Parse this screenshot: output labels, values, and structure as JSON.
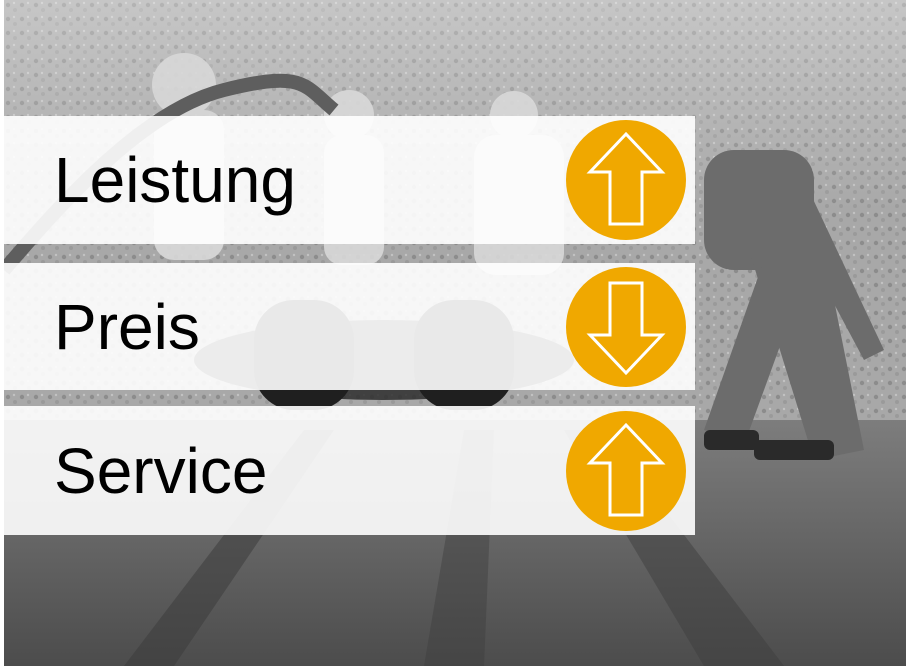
{
  "rows": [
    {
      "label": "Leistung",
      "trend": "up",
      "icon": "arrow-up-icon"
    },
    {
      "label": "Preis",
      "trend": "down",
      "icon": "arrow-down-icon"
    },
    {
      "label": "Service",
      "trend": "up",
      "icon": "arrow-up-icon"
    }
  ],
  "colors": {
    "accent": "#f0a800",
    "panel": "#ffffff",
    "text": "#000000"
  },
  "background": {
    "description_icon": "pit-stop-photo"
  }
}
